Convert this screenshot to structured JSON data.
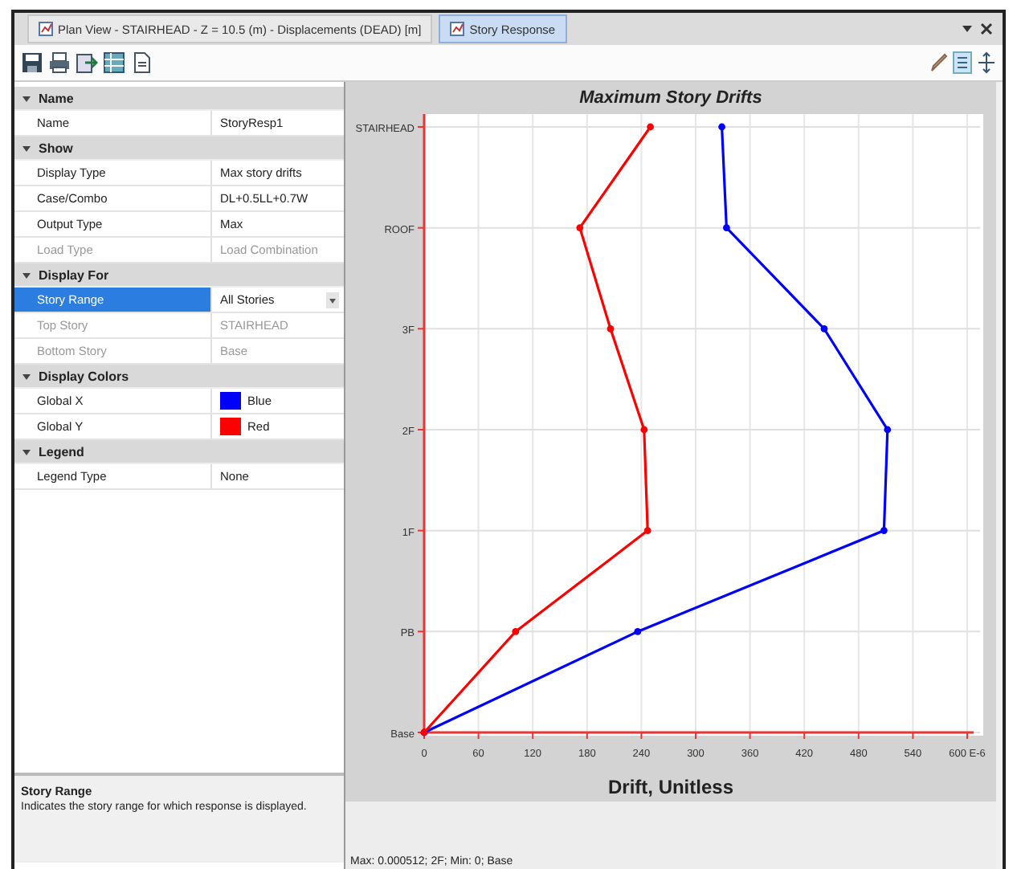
{
  "tabs": [
    {
      "label": "Plan View - STAIRHEAD - Z = 10.5 (m) - Displacements (DEAD) [m]",
      "selected": false
    },
    {
      "label": "Story Response",
      "selected": true
    }
  ],
  "property_grid": {
    "categories": [
      {
        "title": "Name",
        "expanded": true,
        "rows": [
          {
            "label": "Name",
            "value": "StoryResp1",
            "disabled": false,
            "selected": false
          }
        ]
      },
      {
        "title": "Show",
        "expanded": true,
        "rows": [
          {
            "label": "Display Type",
            "value": "Max story drifts",
            "disabled": false,
            "selected": false
          },
          {
            "label": "Case/Combo",
            "value": "DL+0.5LL+0.7W",
            "disabled": false,
            "selected": false
          },
          {
            "label": "Output Type",
            "value": "Max",
            "disabled": false,
            "selected": false
          },
          {
            "label": "Load Type",
            "value": "Load Combination",
            "disabled": true,
            "selected": false
          }
        ]
      },
      {
        "title": "Display For",
        "expanded": true,
        "rows": [
          {
            "label": "Story Range",
            "value": "All Stories",
            "disabled": false,
            "selected": true,
            "dropdown": true
          },
          {
            "label": "Top Story",
            "value": "STAIRHEAD",
            "disabled": true,
            "selected": false
          },
          {
            "label": "Bottom Story",
            "value": "Base",
            "disabled": true,
            "selected": false
          }
        ]
      },
      {
        "title": "Display Colors",
        "expanded": true,
        "rows": [
          {
            "label": "Global X",
            "value": "Blue",
            "disabled": false,
            "selected": false,
            "color": "#0000ff"
          },
          {
            "label": "Global Y",
            "value": "Red",
            "disabled": false,
            "selected": false,
            "color": "#ff0000"
          }
        ]
      },
      {
        "title": "Legend",
        "expanded": true,
        "rows": [
          {
            "label": "Legend Type",
            "value": "None",
            "disabled": false,
            "selected": false
          }
        ]
      }
    ]
  },
  "description": {
    "title": "Story Range",
    "text": "Indicates the story range for which response is displayed."
  },
  "chart_panel": {
    "chart_data": {
      "type": "line",
      "orientation": "horizontal",
      "grid": true,
      "title": "Maximum Story Drifts",
      "xlabel": "Drift, Unitless",
      "categories": [
        "STAIRHEAD",
        "ROOF",
        "3F",
        "2F",
        "1F",
        "PB",
        "Base"
      ],
      "series": [
        {
          "color": "#0000ff",
          "marker": "circle",
          "values": [
            329,
            334,
            442,
            512,
            508,
            236,
            0
          ]
        },
        {
          "color": "#ff0000",
          "marker": "circle",
          "values": [
            250,
            172,
            206,
            243,
            247,
            101,
            0
          ]
        }
      ],
      "xlim": [
        0,
        600
      ],
      "xticks": [
        0,
        60,
        120,
        180,
        240,
        300,
        360,
        420,
        480,
        540,
        {
          "value": 600,
          "label": "600 E-6"
        }
      ]
    },
    "status": "Max: 0.000512; 2F; Min: 0; Base"
  }
}
